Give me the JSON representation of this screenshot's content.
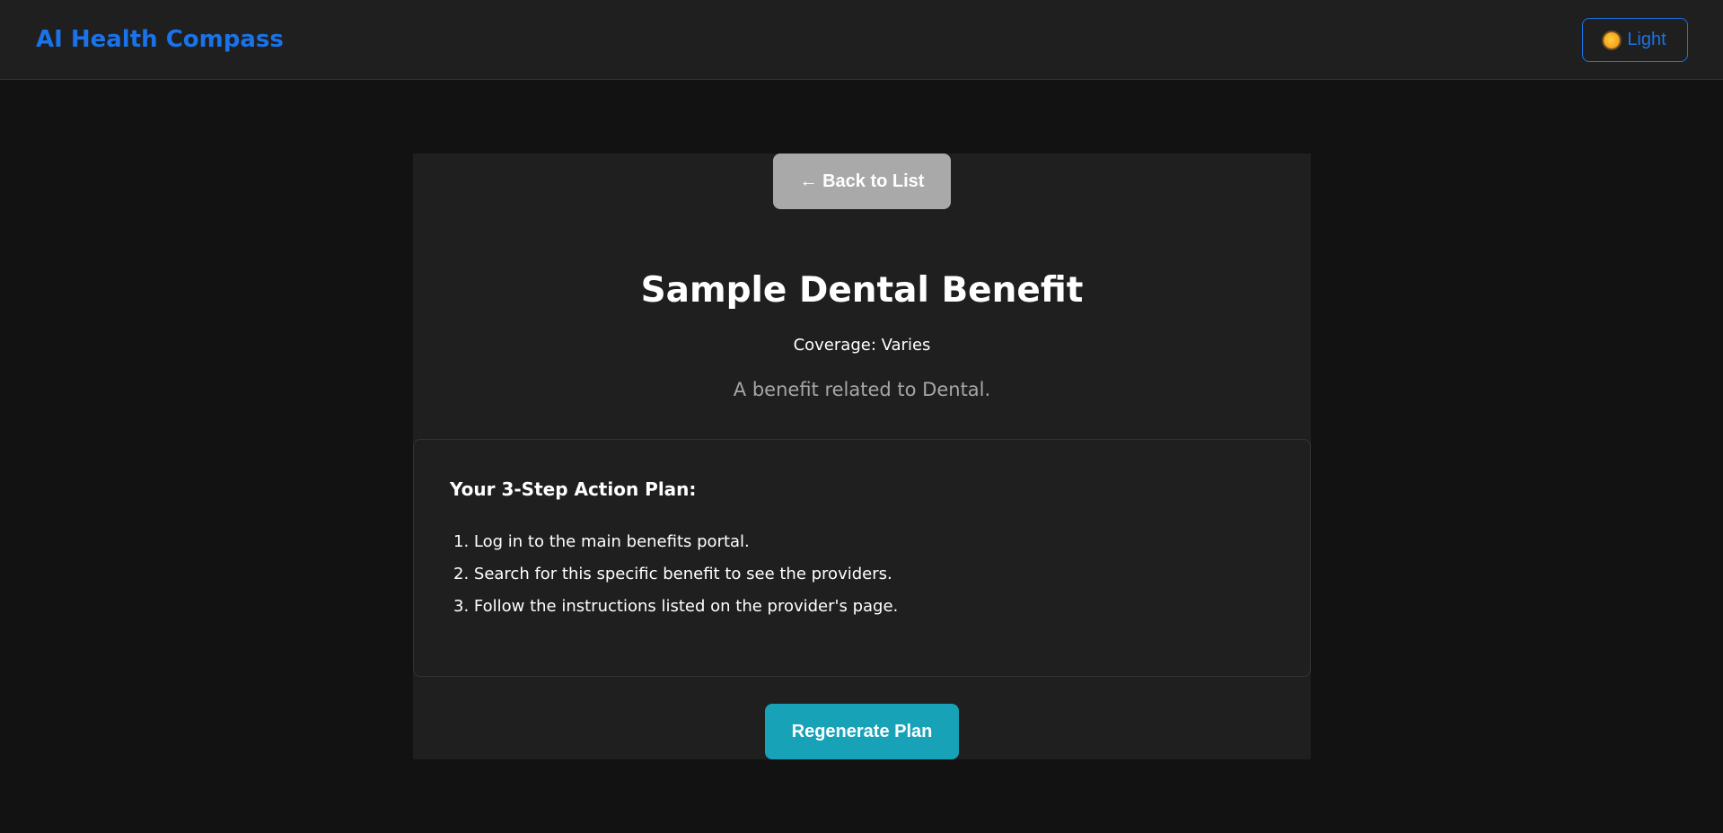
{
  "header": {
    "brand": "AI Health Compass",
    "theme_toggle": {
      "icon": "sun-icon",
      "label": "Light"
    }
  },
  "benefit": {
    "back_label": "← Back to List",
    "title": "Sample Dental Benefit",
    "coverage": "Coverage: Varies",
    "description": "A benefit related to Dental."
  },
  "plan": {
    "heading": "Your 3-Step Action Plan:",
    "steps": [
      "1. Log in to the main benefits portal.",
      "2. Search for this specific benefit to see the providers.",
      "3. Follow the instructions listed on the provider's page."
    ],
    "regenerate_label": "Regenerate Plan"
  },
  "colors": {
    "accent": "#1a73e8",
    "back_button": "#a9a9a9",
    "regenerate_button": "#17a2b8",
    "background": "#121212",
    "surface": "#1f1f1f"
  }
}
